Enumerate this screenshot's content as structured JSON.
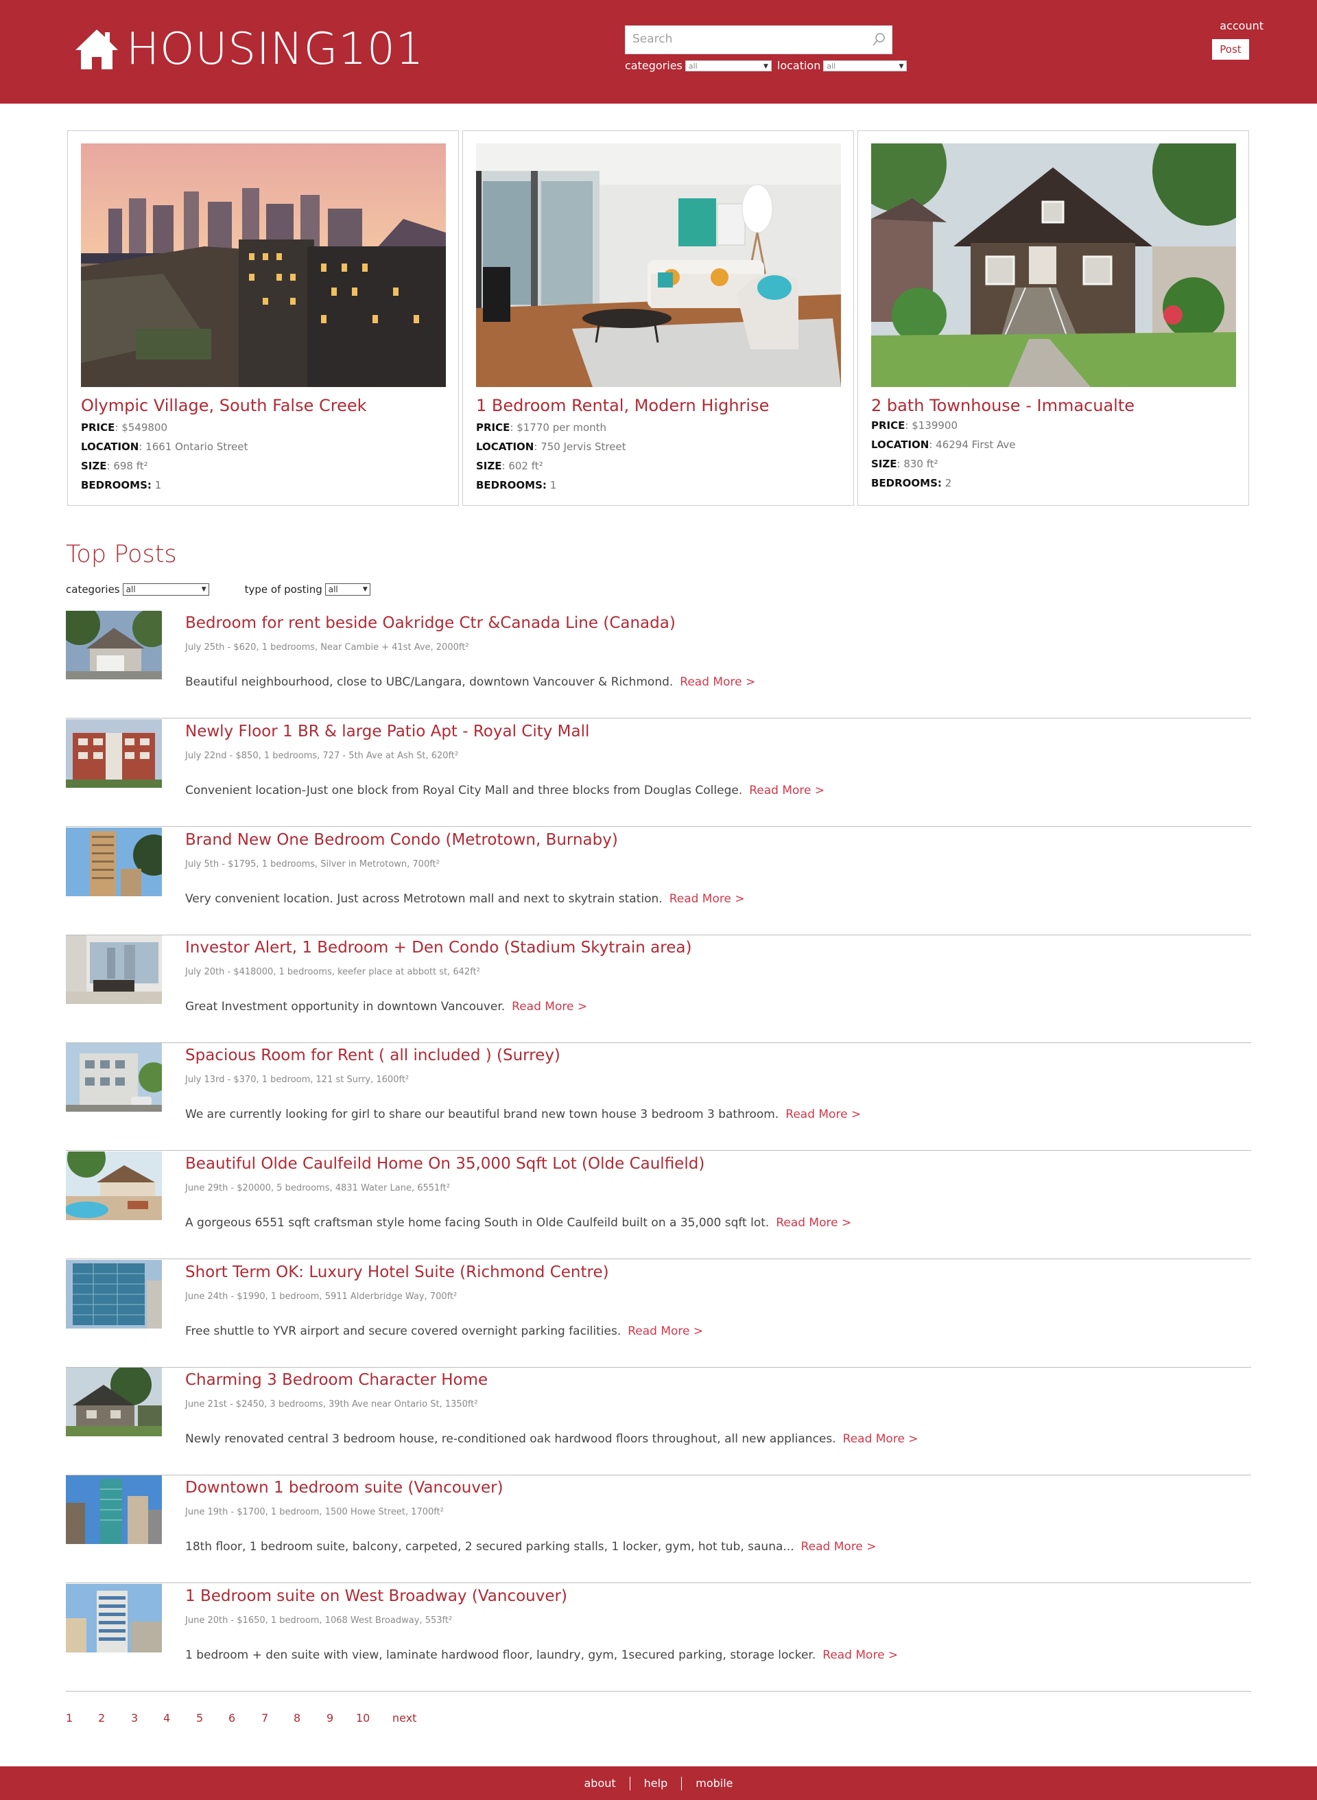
{
  "header": {
    "logo_text": "HOUSING101",
    "search_placeholder": "Search",
    "categories_label": "categories",
    "categories_value": "all",
    "location_label": "location",
    "location_value": "all",
    "account_label": "account",
    "post_label": "Post"
  },
  "featured": [
    {
      "title": "Olympic Village, South False Creek",
      "price_label": "PRICE",
      "price": ": $549800",
      "location_label": "LOCATION",
      "location": ": 1661 Ontario Street",
      "size_label": "SIZE",
      "size": ": 698 ft²",
      "bedrooms_label": "BEDROOMS:",
      "bedrooms": " 1"
    },
    {
      "title": "1 Bedroom Rental, Modern Highrise",
      "price_label": "PRICE",
      "price": ": $1770 per month",
      "location_label": "LOCATION",
      "location": ": 750 Jervis Street",
      "size_label": "SIZE",
      "size": ": 602 ft²",
      "bedrooms_label": "BEDROOMS:",
      "bedrooms": " 1"
    },
    {
      "title": "2 bath Townhouse - Immacualte",
      "price_label": "PRICE",
      "price": ": $139900",
      "location_label": "LOCATION",
      "location": ": 46294 First Ave",
      "size_label": "SIZE",
      "size": ": 830 ft²",
      "bedrooms_label": "BEDROOMS:",
      "bedrooms": " 2"
    }
  ],
  "top_posts": {
    "title": "Top Posts",
    "categories_label": "categories",
    "categories_value": "all",
    "type_label": "type of posting",
    "type_value": "all",
    "read_more": "Read More >",
    "posts": [
      {
        "title": "Bedroom for rent beside Oakridge Ctr &Canada Line (Canada)",
        "meta": "July 25th - $620, 1 bedrooms, Near Cambie + 41st Ave, 2000ft²",
        "desc": "Beautiful neighbourhood, close to UBC/Langara, downtown Vancouver & Richmond."
      },
      {
        "title": "Newly Floor 1 BR & large Patio Apt - Royal City Mall",
        "meta": "July 22nd - $850, 1 bedrooms, 727 - 5th Ave at Ash St, 620ft²",
        "desc": "Convenient location-Just one block from Royal City Mall and three blocks from Douglas College."
      },
      {
        "title": "Brand New One Bedroom Condo (Metrotown, Burnaby)",
        "meta": "July 5th - $1795, 1 bedrooms, Silver in Metrotown, 700ft²",
        "desc": "Very convenient location. Just across Metrotown mall and next to skytrain station."
      },
      {
        "title": "Investor Alert, 1 Bedroom + Den Condo (Stadium Skytrain area)",
        "meta": "July 20th - $418000, 1 bedrooms, keefer place at abbott st, 642ft²",
        "desc": "Great Investment opportunity in downtown Vancouver."
      },
      {
        "title": "Spacious Room for Rent ( all included ) (Surrey)",
        "meta": "July 13rd - $370, 1 bedroom, 121 st Surry, 1600ft²",
        "desc": "We are currently looking for girl to share our beautiful brand new town house 3 bedroom 3 bathroom."
      },
      {
        "title": "Beautiful Olde Caulfeild Home On 35,000 Sqft Lot (Olde Caulfield)",
        "meta": "June 29th - $20000, 5 bedrooms, 4831 Water Lane, 6551ft²",
        "desc": "A gorgeous 6551 sqft craftsman style home facing South in Olde Caulfeild built on a 35,000 sqft lot."
      },
      {
        "title": "Short Term OK: Luxury Hotel Suite (Richmond Centre)",
        "meta": "June 24th - $1990, 1 bedroom, 5911 Alderbridge Way, 700ft²",
        "desc": "Free shuttle to YVR airport and secure covered overnight parking facilities."
      },
      {
        "title": "Charming 3 Bedroom Character Home",
        "meta": "June 21st - $2450, 3 bedrooms, 39th Ave near Ontario St, 1350ft²",
        "desc": "Newly renovated central 3 bedroom house, re-conditioned oak hardwood floors throughout, all new appliances."
      },
      {
        "title": "Downtown 1 bedroom suite (Vancouver)",
        "meta": "June 19th - $1700, 1 bedroom, 1500 Howe Street, 1700ft²",
        "desc": "18th floor, 1 bedroom suite, balcony, carpeted, 2 secured parking stalls, 1 locker, gym, hot tub, sauna..."
      },
      {
        "title": "1 Bedroom suite on West Broadway (Vancouver)",
        "meta": "June 20th - $1650, 1 bedroom, 1068 West Broadway, 553ft²",
        "desc": "1 bedroom + den suite with view, laminate hardwood floor, laundry, gym, 1secured parking, storage locker."
      }
    ]
  },
  "pagination": [
    "1",
    "2",
    "3",
    "4",
    "5",
    "6",
    "7",
    "8",
    "9",
    "10",
    "next"
  ],
  "footer": {
    "about": "about",
    "help": "help",
    "mobile": "mobile"
  },
  "colors": {
    "brand": "#b12a34",
    "link": "#d2384a"
  }
}
